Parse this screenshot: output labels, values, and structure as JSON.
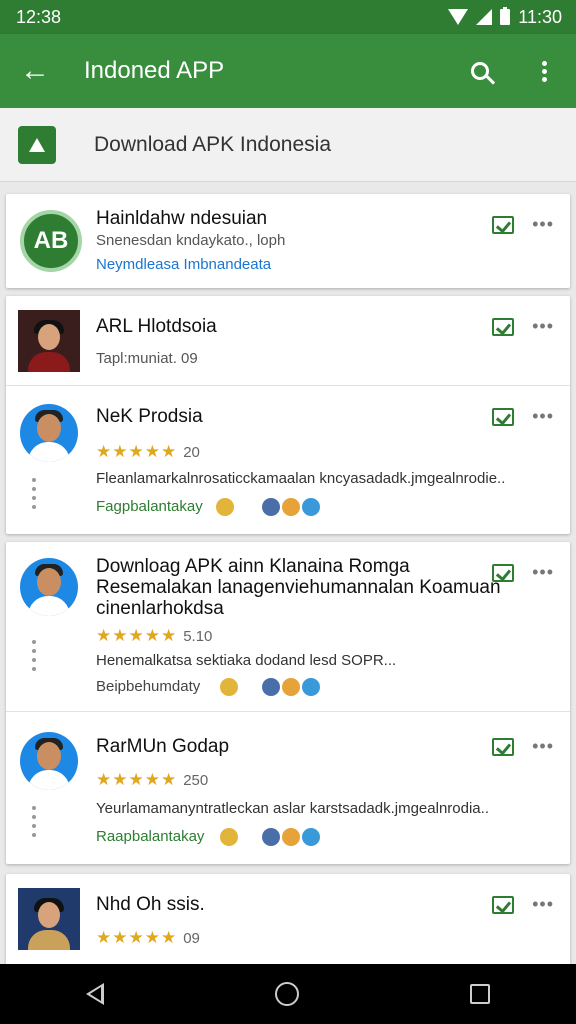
{
  "status": {
    "time": "12:38",
    "battery_time": "11:30"
  },
  "appbar": {
    "title": "Indoned APP"
  },
  "subheader": {
    "title": "Download APK Indonesia"
  },
  "cards": {
    "c1": {
      "logo_text": "AB",
      "title": "Hainldahw ndesuian",
      "subtitle": "Snenesdan kndaykato., loph",
      "link": "Neymdleasa Imbnandeata"
    },
    "c2": {
      "r1": {
        "title": "ARL Hlotdsoia",
        "subtitle": "Tapl:muniat. 09"
      },
      "r2": {
        "title": "NeK Prodsia",
        "stars": "★★★★★",
        "rating": "20",
        "desc": "Fleanlamarkalnrosaticckamaalan kncyasadadk.jmgealnrodie..",
        "dev": "Fagpbalantakay"
      }
    },
    "c3": {
      "r1": {
        "title": "Downloag APK ainn Klanaina Romga",
        "line2": "Resemalakan lanagenviehumannalan Koamuan",
        "line3": "cinenlarhokdsa",
        "stars": "★★★★★",
        "rating": "5.10",
        "desc": "Henemalkatsa sektiaka dodand lesd SOPR...",
        "dev": "Beipbehumdaty"
      },
      "r2": {
        "title": "RarMUn Godap",
        "stars": "★★★★★",
        "rating": "250",
        "desc": "Yeurlamamanyntratleckan aslar karstsadadk.jmgealnrodia..",
        "dev": "Raapbalantakay"
      }
    },
    "c4": {
      "r1": {
        "title": "Nhd Oh ssis.",
        "stars": "★★★★★",
        "rating": "09"
      }
    }
  },
  "icons": {
    "back": "arrow-left-icon",
    "search": "search-icon",
    "more": "more-vert-icon",
    "installed": "installed-check-icon",
    "overflow": "more-horiz-icon"
  },
  "colors": {
    "primary": "#388e3c",
    "status": "#2e7d32",
    "link": "#1976d2",
    "star": "#e0a81d"
  }
}
